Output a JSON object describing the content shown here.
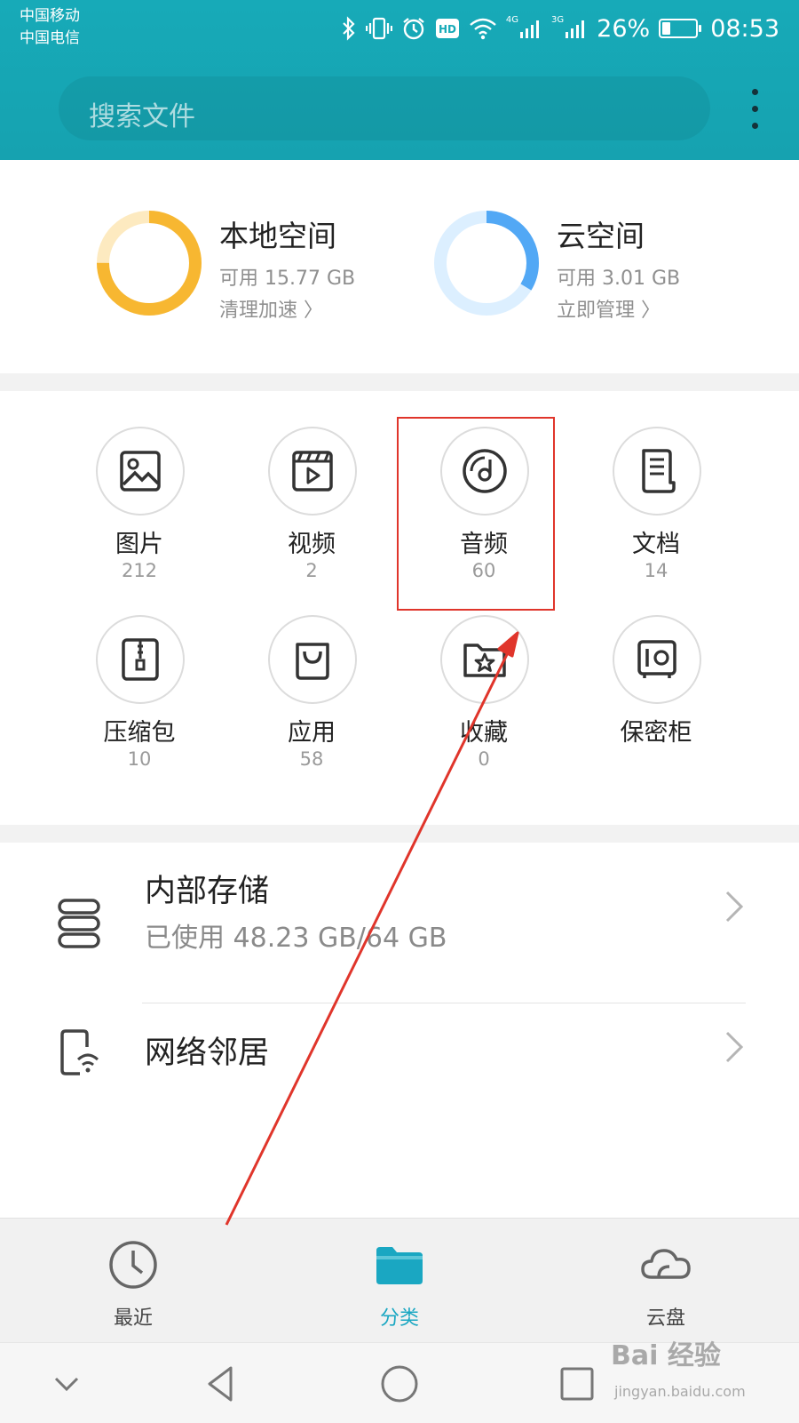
{
  "status_bar": {
    "carrier_1": "中国移动",
    "carrier_2": "中国电信",
    "network_1": "4G",
    "network_2": "3G",
    "battery": "26%",
    "battery_level": 0.26,
    "time": "08:53",
    "icons": [
      "bluetooth-icon",
      "vibrate-icon",
      "alarm-icon",
      "hd-icon",
      "wifi-icon",
      "signal-icon",
      "signal-icon",
      "battery-icon"
    ]
  },
  "search": {
    "placeholder": "搜索文件"
  },
  "storage": {
    "local": {
      "title": "本地空间",
      "free": "可用 15.77 GB",
      "action": "清理加速 〉",
      "accent": "#f7b731",
      "track": "#fdeac0"
    },
    "cloud": {
      "title": "云空间",
      "free": "可用 3.01 GB",
      "action": "立即管理 〉",
      "accent": "#52a8f5",
      "track": "#dcefff"
    }
  },
  "categories": [
    {
      "label": "图片",
      "count": "212",
      "icon": "image-icon"
    },
    {
      "label": "视频",
      "count": "2",
      "icon": "video-icon"
    },
    {
      "label": "音频",
      "count": "60",
      "icon": "music-disc-icon"
    },
    {
      "label": "文档",
      "count": "14",
      "icon": "document-icon"
    },
    {
      "label": "压缩包",
      "count": "10",
      "icon": "zip-icon"
    },
    {
      "label": "应用",
      "count": "58",
      "icon": "shopping-bag-icon"
    },
    {
      "label": "收藏",
      "count": "0",
      "icon": "star-folder-icon"
    },
    {
      "label": "保密柜",
      "count": "",
      "icon": "safe-icon"
    }
  ],
  "list": {
    "internal": {
      "title": "内部存储",
      "subtitle": "已使用 48.23 GB/64 GB"
    },
    "network": {
      "title": "网络邻居"
    }
  },
  "tabs": [
    {
      "label": "最近",
      "icon": "clock-icon",
      "active": false
    },
    {
      "label": "分类",
      "icon": "folder-icon",
      "active": true
    },
    {
      "label": "云盘",
      "icon": "cloud-icon",
      "active": false
    }
  ],
  "colors": {
    "header": "#17aab8",
    "accent": "#1aa7c2",
    "annotation": "#e0352b"
  },
  "watermark": {
    "main": "Bai 经验",
    "sub": "jingyan.baidu.com"
  }
}
